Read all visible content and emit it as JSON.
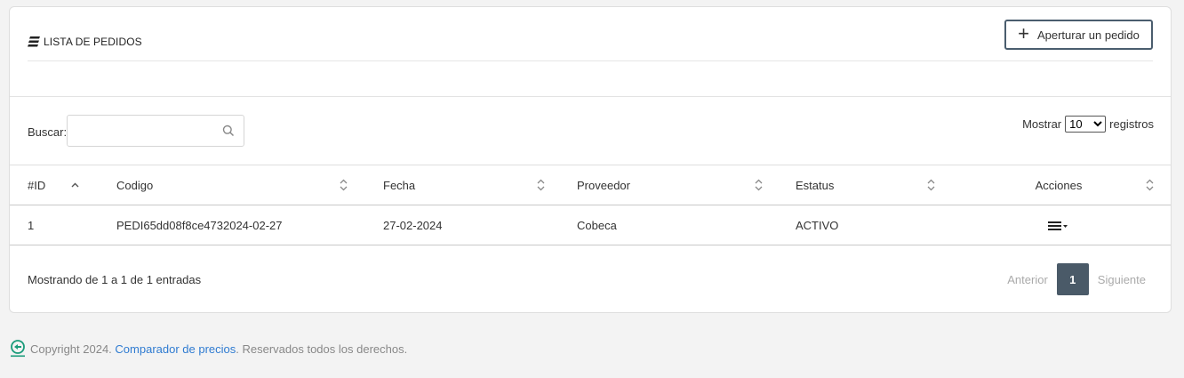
{
  "header": {
    "title": "LISTA DE PEDIDOS",
    "title_icon": "list-icon",
    "open_button_label": "Aperturar un pedido"
  },
  "search": {
    "label": "Buscar:",
    "value": "",
    "placeholder": ""
  },
  "show": {
    "prefix": "Mostrar",
    "selected": "10",
    "options": [
      "10"
    ],
    "suffix": "registros"
  },
  "table": {
    "columns": [
      "#ID",
      "Codigo",
      "Fecha",
      "Proveedor",
      "Estatus",
      "Acciones"
    ],
    "rows": [
      {
        "id": "1",
        "codigo": "PEDI65dd08f8ce4732024-02-27",
        "fecha": "27-02-2024",
        "proveedor": "Cobeca",
        "estatus": "ACTIVO"
      }
    ]
  },
  "info": "Mostrando de 1 a 1 de 1 entradas",
  "pagination": {
    "prev": "Anterior",
    "current": "1",
    "next": "Siguiente"
  },
  "footer": {
    "prefix": "Copyright 2024.",
    "link": "Comparador de precios",
    "suffix": ". Reservados todos los derechos."
  },
  "colors": {
    "accent": "#4a5a68",
    "link": "#2f7bd1",
    "logo": "#1a9b7a"
  }
}
